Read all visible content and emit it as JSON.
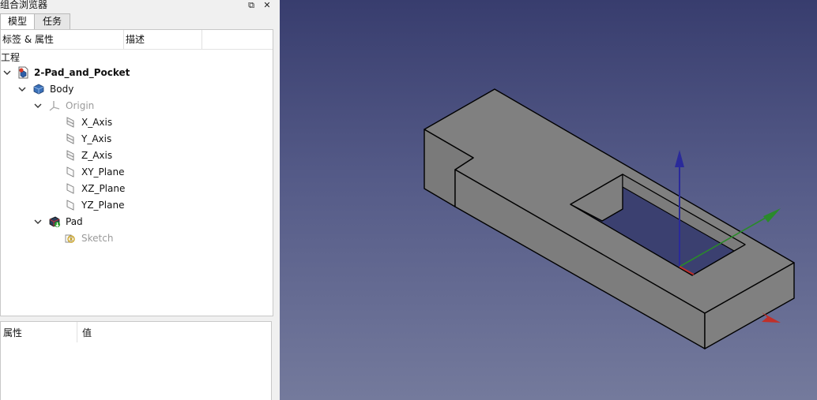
{
  "panel": {
    "title": "组合浏览器",
    "float_glyph": "⧉",
    "close_glyph": "✕",
    "tabs": [
      {
        "label": "模型",
        "active": true
      },
      {
        "label": "任务",
        "active": false
      }
    ]
  },
  "tree": {
    "headers": {
      "label": "标签 & 属性",
      "desc": "描述"
    },
    "section": "工程",
    "items": [
      {
        "label": "2-Pad_and_Pocket",
        "icon": "document-part-icon",
        "expanded": true,
        "bold": true
      },
      {
        "label": "Body",
        "icon": "body-icon",
        "expanded": true
      },
      {
        "label": "Origin",
        "icon": "origin-icon",
        "expanded": true,
        "dimmed": true
      },
      {
        "label": "X_Axis",
        "icon": "axis-icon"
      },
      {
        "label": "Y_Axis",
        "icon": "axis-icon"
      },
      {
        "label": "Z_Axis",
        "icon": "axis-icon"
      },
      {
        "label": "XY_Plane",
        "icon": "plane-icon"
      },
      {
        "label": "XZ_Plane",
        "icon": "plane-icon"
      },
      {
        "label": "YZ_Plane",
        "icon": "plane-icon"
      },
      {
        "label": "Pad",
        "icon": "pad-icon",
        "expanded": true
      },
      {
        "label": "Sketch",
        "icon": "sketch-icon",
        "dimmed": true
      }
    ]
  },
  "properties": {
    "headers": {
      "property": "属性",
      "value": "值"
    }
  },
  "viewport": {
    "bg_top": "#383d6e",
    "bg_bottom": "#747a9c",
    "part_face": "#7f7f7f",
    "axis_colors": {
      "x": "#c0302a",
      "y": "#2a8a2a",
      "z": "#2a2a9a"
    }
  }
}
